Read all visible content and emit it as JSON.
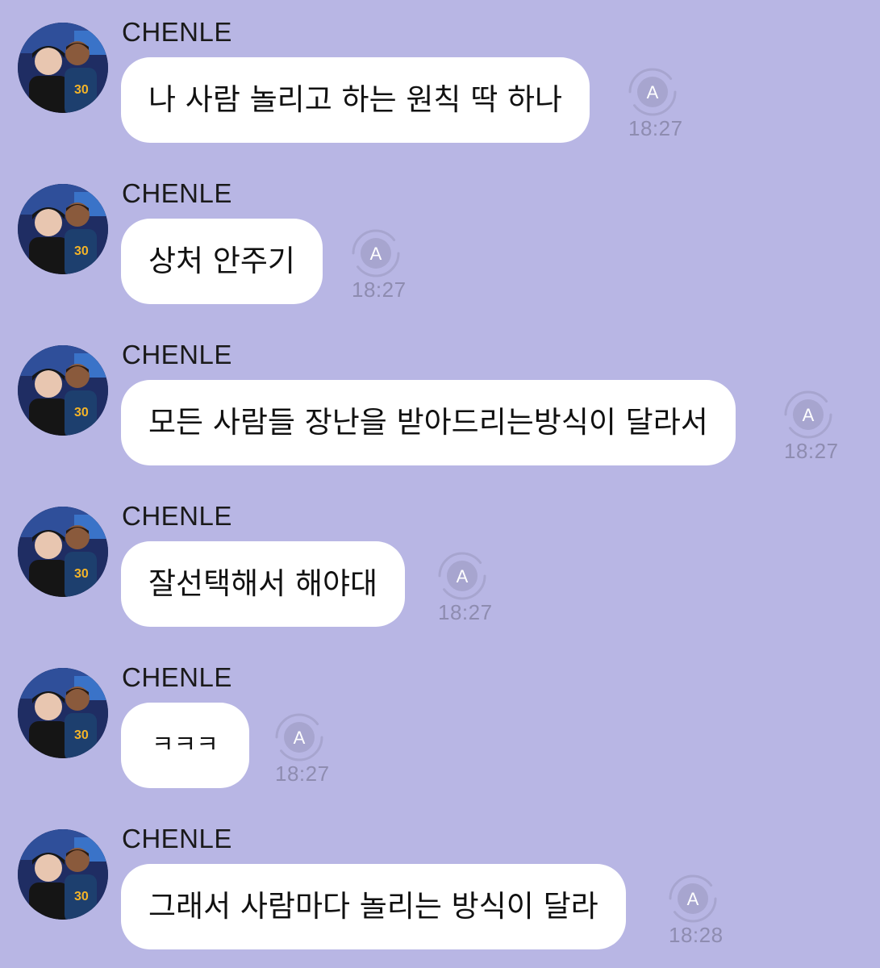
{
  "chat": {
    "messages": [
      {
        "sender": "CHENLE",
        "text": "나 사람 놀리고 하는 원칙 딱 하나",
        "time": "18:27"
      },
      {
        "sender": "CHENLE",
        "text": "상처 안주기",
        "time": "18:27"
      },
      {
        "sender": "CHENLE",
        "text": "모든 사람들 장난을 받아드리는방식이 달라서",
        "time": "18:27"
      },
      {
        "sender": "CHENLE",
        "text": "잘선택해서 해야대",
        "time": "18:27"
      },
      {
        "sender": "CHENLE",
        "text": "ㅋㅋㅋ",
        "time": "18:27"
      },
      {
        "sender": "CHENLE",
        "text": "그래서 사람마다 놀리는 방식이 달라",
        "time": "18:28"
      }
    ]
  },
  "colors": {
    "background": "#b8b6e4",
    "bubble": "#ffffff",
    "timestamp": "#8e8cb0",
    "translate_icon": "#a7a5cf"
  },
  "icons": {
    "avatar": "profile-photo",
    "translate": "translate-icon"
  }
}
